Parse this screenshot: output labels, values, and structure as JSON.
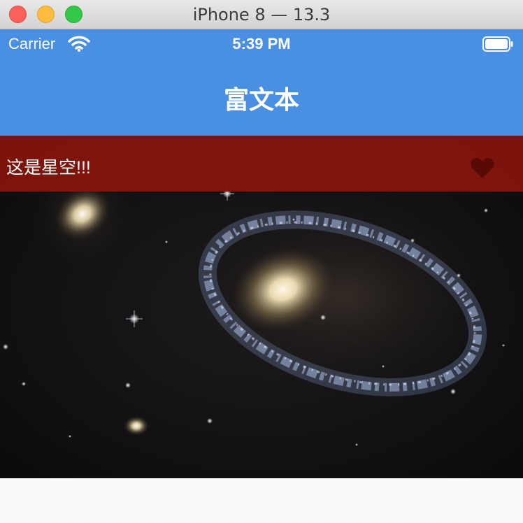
{
  "window": {
    "title": "iPhone 8 — 13.3",
    "controls": [
      "close",
      "minimize",
      "zoom"
    ]
  },
  "status_bar": {
    "carrier": "Carrier",
    "time": "5:39 PM",
    "icons": [
      "wifi-icon",
      "battery-icon"
    ]
  },
  "nav_bar": {
    "title": "富文本",
    "color": "#4a90e2"
  },
  "card": {
    "caption": "这是星空!!!",
    "overlay_color": "#87160c",
    "favorite_icon": "heart-icon",
    "image": "galaxy-ring-starfield"
  }
}
